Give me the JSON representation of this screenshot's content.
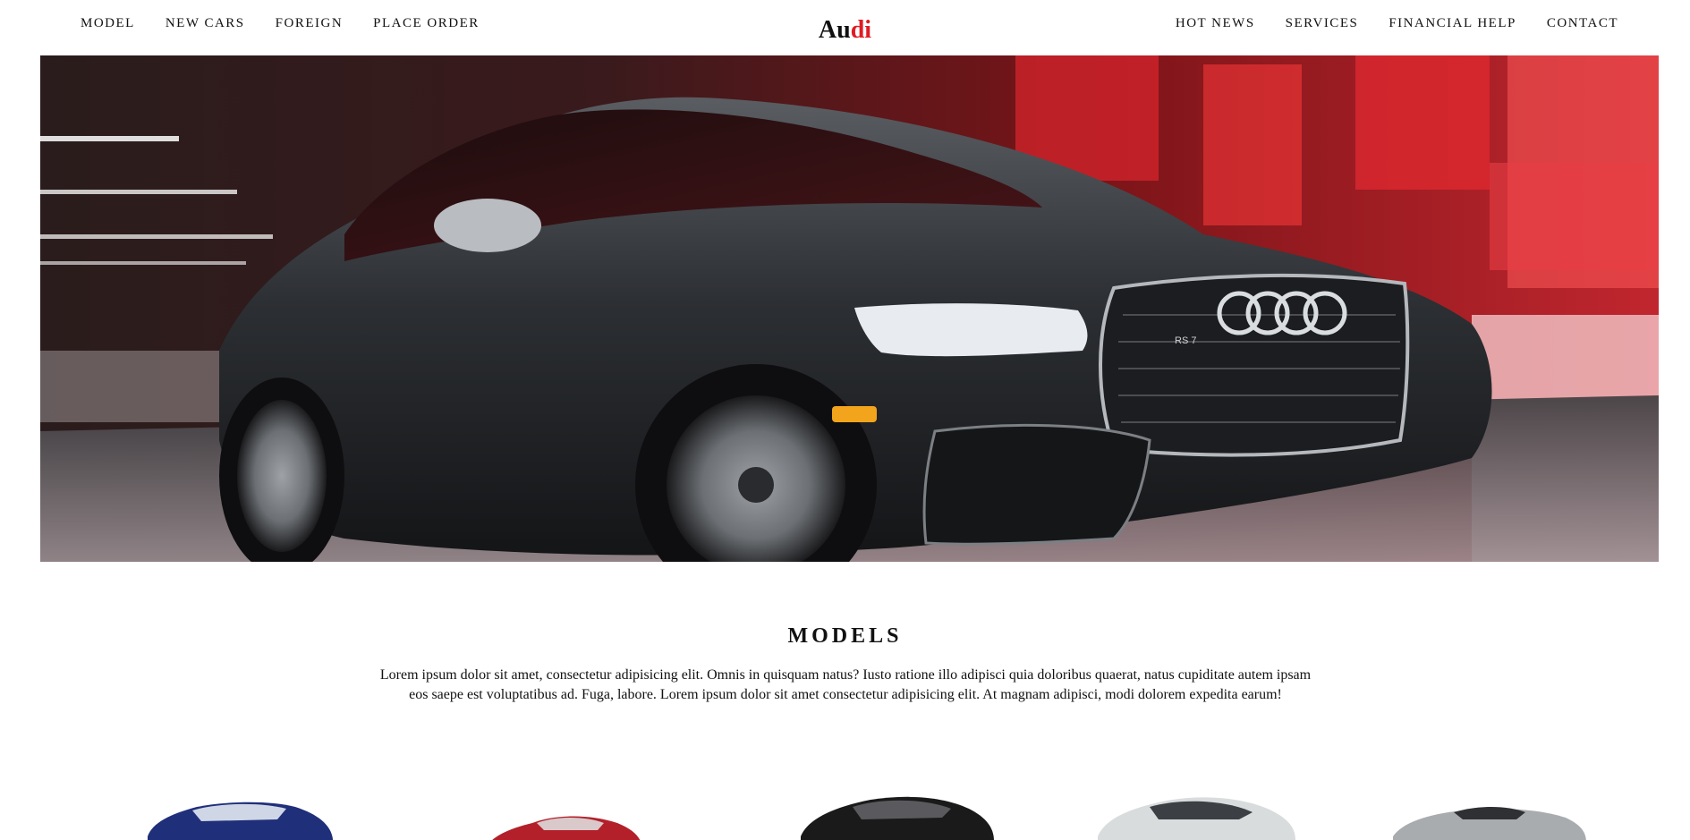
{
  "nav": {
    "left": [
      "MODEL",
      "NEW CARS",
      "FOREIGN",
      "PLACE ORDER"
    ],
    "right": [
      "HOT NEWS",
      "SERVICES",
      "FINANCIAL HELP",
      "CONTACT"
    ],
    "logo_part1": "Au",
    "logo_part2": "di"
  },
  "hero": {
    "image": "black-audi-rs7-hero-image",
    "badge_text": "RS 7"
  },
  "models": {
    "title": "MODELS",
    "description": "Lorem ipsum dolor sit amet, consectetur adipisicing elit. Omnis in quisquam natus? Iusto ratione illo adipisci quia doloribus quaerat, natus cupiditate autem ipsam eos saepe est voluptatibus ad. Fuga, labore. Lorem ipsum dolor sit amet consectetur adipisicing elit. At magnam adipisci, modi dolorem expedita earum!",
    "cars": [
      {
        "name": "blue-suv",
        "color": "#1f2f7a"
      },
      {
        "name": "red-sedan",
        "color": "#b3202a"
      },
      {
        "name": "black-sedan",
        "color": "#1a1a1a"
      },
      {
        "name": "white-coupe",
        "color": "#d9dcdd"
      },
      {
        "name": "silver-convertible",
        "color": "#a9acae"
      }
    ]
  },
  "colors": {
    "accent": "#e01b24",
    "text": "#111111",
    "background": "#ffffff"
  }
}
